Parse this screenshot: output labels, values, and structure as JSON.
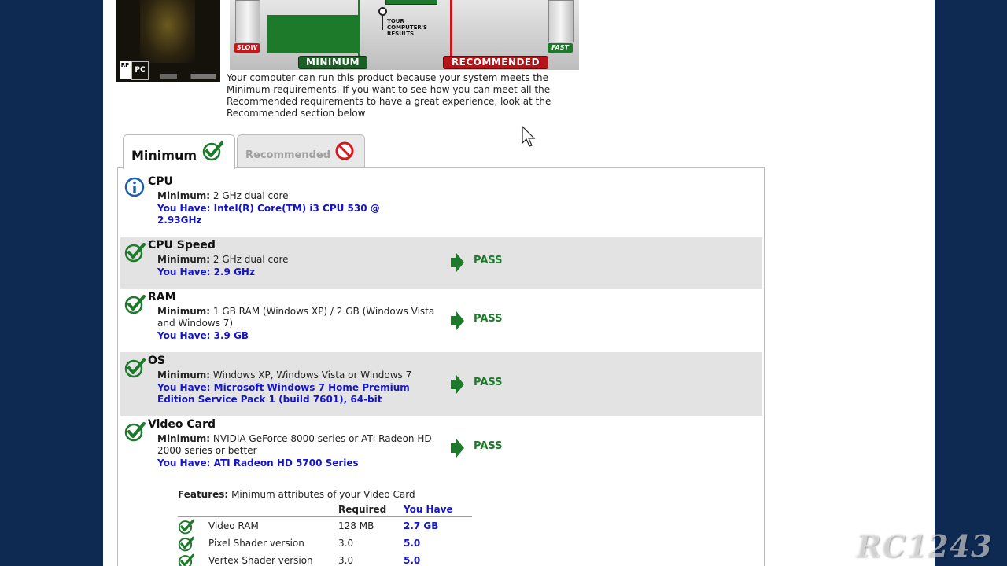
{
  "boxart": {
    "rating_badge": "RP",
    "platform_badge": "PC"
  },
  "meter": {
    "slow_tag": "SLOW",
    "fast_tag": "FAST",
    "minimum_label": "MINIMUM",
    "recommended_label": "RECOMMENDED",
    "your_results_label": "YOUR COMPUTER'S RESULTS"
  },
  "intro_text": "Your computer can run this product because your system meets the Minimum requirements. If you want to see how you can meet all the Recommended requirements to have a great experience, look at the Recommended section below",
  "tabs": [
    {
      "label": "Minimum",
      "status_icon": "check-icon",
      "active": true
    },
    {
      "label": "Recommended",
      "status_icon": "prohibited-icon",
      "active": false
    }
  ],
  "requirements": [
    {
      "title": "CPU",
      "status_icon": "info-icon",
      "min_label": "Minimum:",
      "min_value": "2 GHz dual core",
      "have": "You Have: Intel(R) Core(TM) i3 CPU 530 @ 2.93GHz",
      "result": ""
    },
    {
      "title": "CPU Speed",
      "status_icon": "check-icon",
      "min_label": "Minimum:",
      "min_value": "2 GHz dual core",
      "have": "You Have: 2.9 GHz",
      "result": "PASS"
    },
    {
      "title": "RAM",
      "status_icon": "check-icon",
      "min_label": "Minimum:",
      "min_value": "1 GB RAM (Windows XP) / 2 GB (Windows Vista and Windows 7)",
      "have": "You Have: 3.9 GB",
      "result": "PASS"
    },
    {
      "title": "OS",
      "status_icon": "check-icon",
      "min_label": "Minimum:",
      "min_value": "Windows XP, Windows Vista or Windows 7",
      "have": "You Have: Microsoft Windows 7 Home Premium Edition Service Pack 1 (build 7601), 64-bit",
      "result": "PASS"
    },
    {
      "title": "Video Card",
      "status_icon": "check-icon",
      "min_label": "Minimum:",
      "min_value": "NVIDIA GeForce 8000 series or ATI Radeon HD 2000 series or better",
      "have": "You Have: ATI Radeon HD 5700 Series",
      "result": "PASS"
    }
  ],
  "features": {
    "label": "Features:",
    "description": "Minimum attributes of your Video Card",
    "col_required": "Required",
    "col_have": "You Have",
    "rows": [
      {
        "name": "Video RAM",
        "required": "128 MB",
        "have": "2.7 GB"
      },
      {
        "name": "Pixel Shader version",
        "required": "3.0",
        "have": "5.0"
      },
      {
        "name": "Vertex Shader version",
        "required": "3.0",
        "have": "5.0"
      }
    ]
  },
  "watermark": "RC1243",
  "colors": {
    "pass_green": "#1d7a2a",
    "have_blue": "#1414c8",
    "fail_red": "#c8171c",
    "background": "#0e2a52"
  }
}
